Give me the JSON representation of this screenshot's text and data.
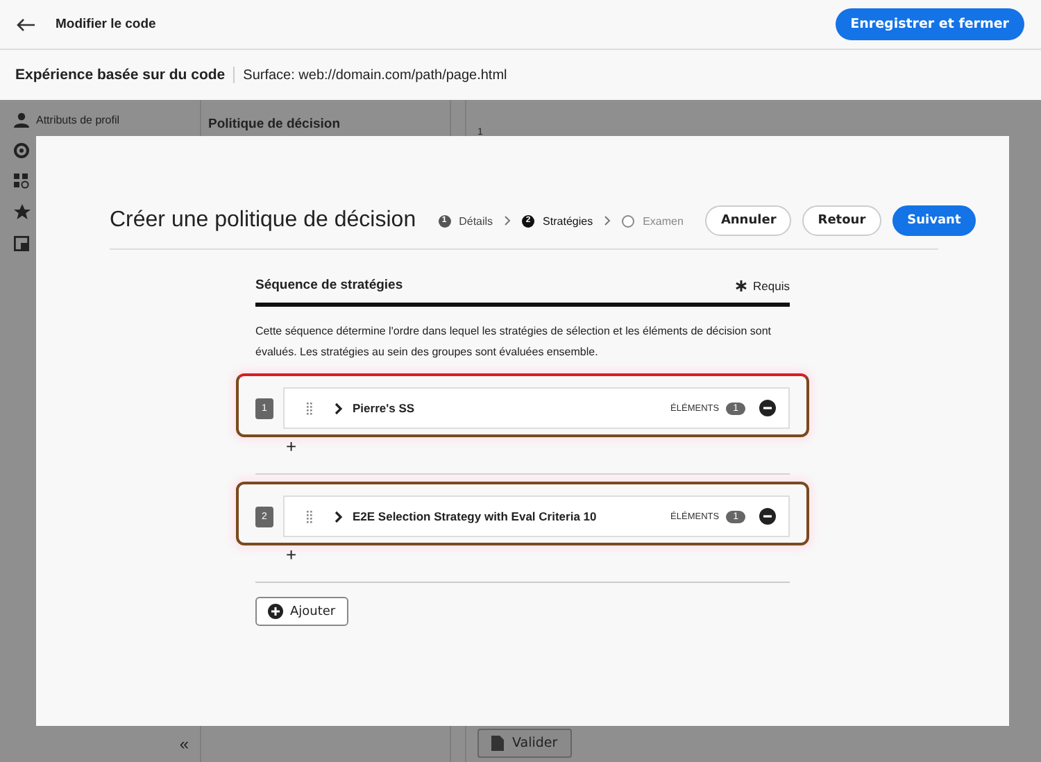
{
  "header": {
    "title": "Modifier le code",
    "save_button": "Enregistrer et fermer"
  },
  "subheader": {
    "title": "Expérience basée sur du code",
    "surface": "Surface: web://domain.com/path/page.html"
  },
  "background": {
    "rail_label": "Attributs de profil",
    "panel_title": "Politique de décision",
    "line_number": "1",
    "collapse": "«",
    "validate_button": "Valider"
  },
  "dialog": {
    "title": "Créer une politique de décision",
    "steps": [
      {
        "number": "1",
        "label": "Détails",
        "kind": "done"
      },
      {
        "number": "2",
        "label": "Stratégies",
        "kind": "current"
      },
      {
        "label": "Examen",
        "kind": "pending"
      }
    ],
    "buttons": [
      {
        "label": "Annuler",
        "kind": "secondary"
      },
      {
        "label": "Retour",
        "kind": "secondary"
      },
      {
        "label": "Suivant",
        "kind": "primary"
      }
    ],
    "section_title": "Séquence de stratégies",
    "required_label": "Requis",
    "description": "Cette séquence détermine l'ordre dans lequel les stratégies de sélection et les éléments de décision sont évalués. Les stratégies au sein des groupes sont évaluées ensemble.",
    "strategies": [
      {
        "number": "1",
        "name": "Pierre's SS",
        "items_label": "ÉLÉMENTS",
        "count": "1",
        "add": "+"
      },
      {
        "number": "2",
        "name": "E2E Selection Strategy with Eval Criteria 10",
        "items_label": "ÉLÉMENTS",
        "count": "1",
        "add": "+"
      }
    ],
    "add_button": "Ajouter"
  }
}
